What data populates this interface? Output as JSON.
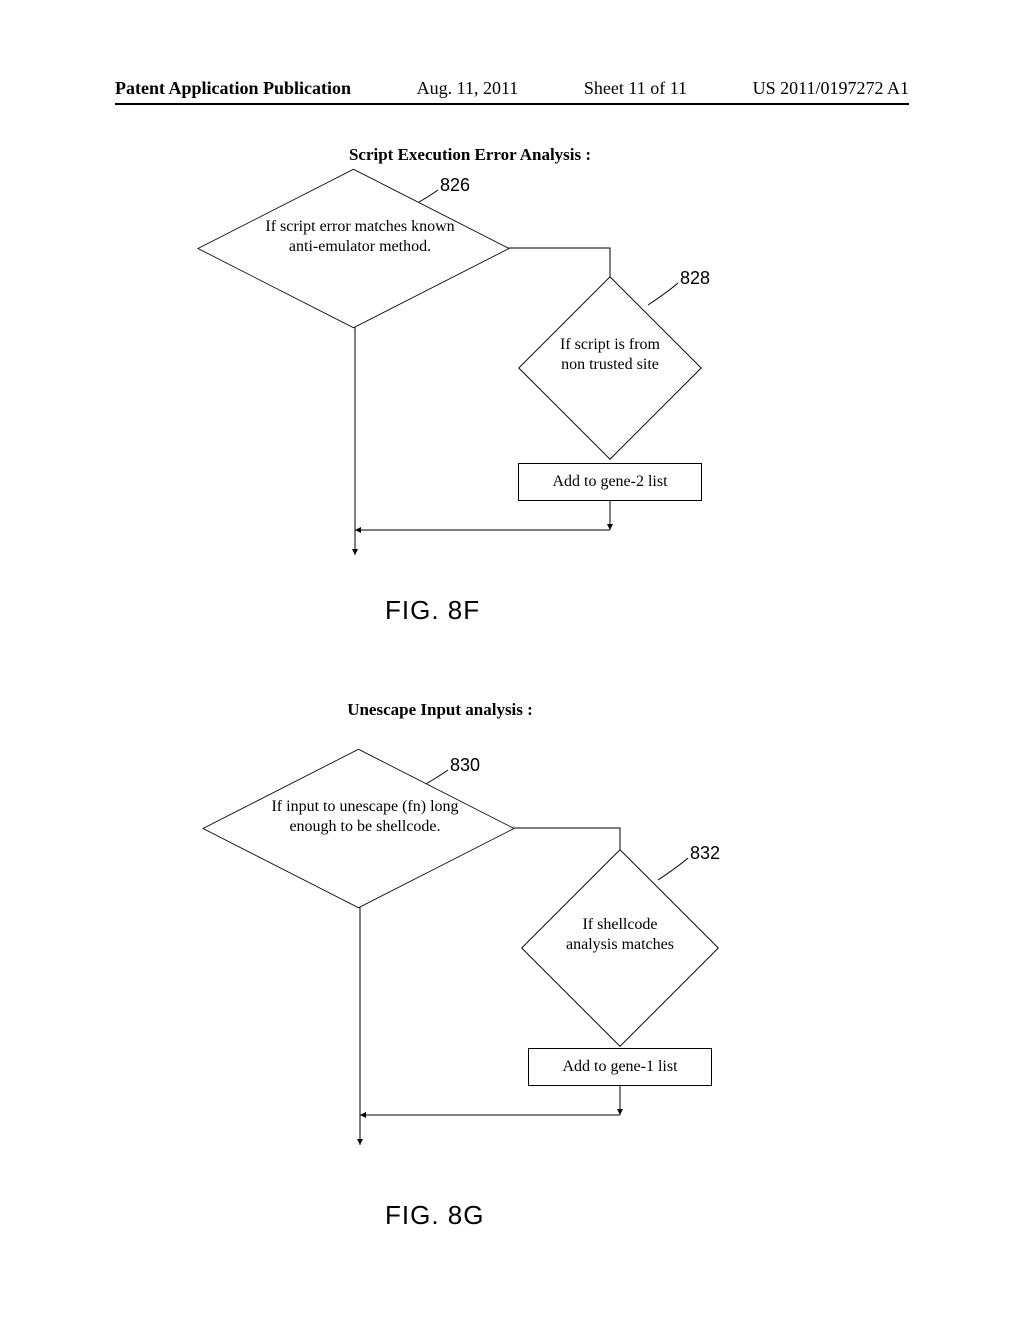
{
  "header": {
    "left": "Patent Application Publication",
    "date": "Aug. 11, 2011",
    "sheet": "Sheet 11 of 11",
    "pubno": "US 2011/0197272 A1"
  },
  "fig8f": {
    "section_title": "Script Execution Error Analysis :",
    "d1_text": "If script error matches known anti-emulator method.",
    "d1_ref": "826",
    "d2_text": "If  script is from non trusted site",
    "d2_ref": "828",
    "r1_text": "Add to gene-2 list",
    "label": "FIG. 8F"
  },
  "fig8g": {
    "section_title": "Unescape Input analysis :",
    "d1_text": "If input to unescape (fn) long enough to be shellcode.",
    "d1_ref": "830",
    "d2_text": "If shellcode analysis matches",
    "d2_ref": "832",
    "r1_text": "Add to gene-1 list",
    "label": "FIG. 8G"
  }
}
